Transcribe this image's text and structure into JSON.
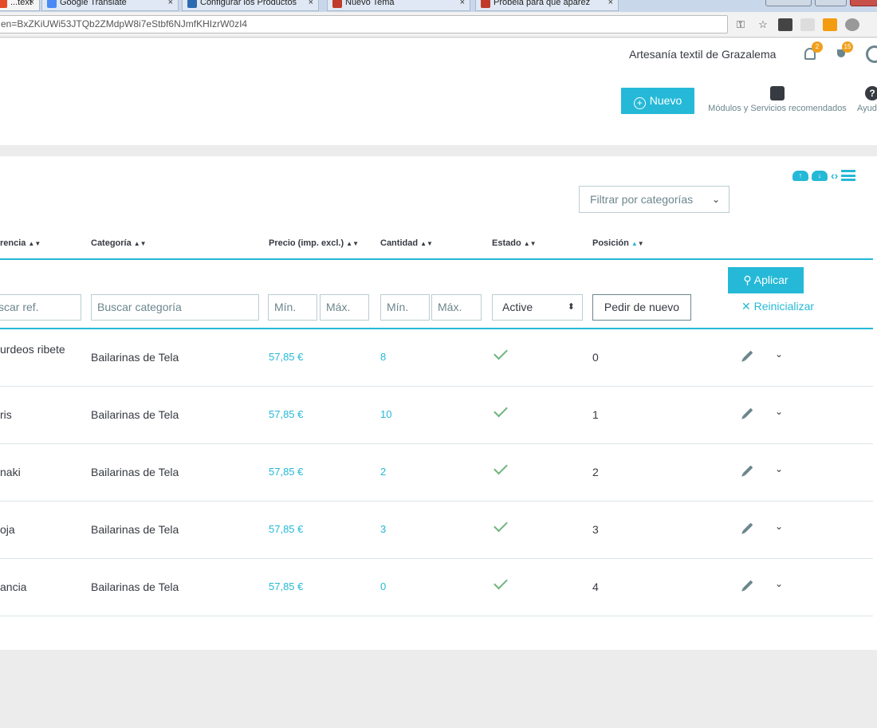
{
  "browser": {
    "tabs": [
      {
        "label": "...text",
        "close": "×"
      },
      {
        "label": "Google Translate",
        "close": "×"
      },
      {
        "label": "Configurar los Productos",
        "close": "×"
      },
      {
        "label": "Nuevo Tema",
        "close": "×"
      },
      {
        "label": "Probela para que aparez",
        "close": "×"
      }
    ],
    "url": "en=BxZKiUWi53JTQb2ZMdpW8i7eStbf6NJmfKHIzrW0zI4",
    "key_icon": "⚿",
    "star_icon": "☆"
  },
  "header": {
    "shop_name": "Artesanía textil de Grazalema",
    "notifications_count": "2",
    "trophy_count": "15",
    "new_button": "Nuevo",
    "new_plus": "+",
    "modules_label": "Módulos y Servicios recomendados",
    "help_label": "Ayuda",
    "help_icon": "?"
  },
  "card": {
    "category_filter": "Filtrar por categorías",
    "category_filter_chevron": "⌄",
    "columns": {
      "reference": "rencia",
      "category": "Categoría",
      "price": "Precio (imp. excl.)",
      "quantity": "Cantidad",
      "status": "Estado",
      "position": "Posición",
      "sort_up": "▲",
      "sort_down": "▼"
    },
    "filters": {
      "ref_placeholder": "scar ref.",
      "category_placeholder": "Buscar categoría",
      "price_min": "Mín.",
      "price_max": "Máx.",
      "qty_min": "Mín.",
      "qty_max": "Máx.",
      "status_value": "Active",
      "status_caret": "⬍",
      "reorder_button": "Pedir de nuevo",
      "apply_button": "Aplicar",
      "apply_icon": "⚲",
      "reset_button": "Reinicializar",
      "reset_icon": "✕"
    },
    "rows": [
      {
        "name": "urdeos ribete",
        "category": "Bailarinas de Tela",
        "price": "57,85 €",
        "quantity": "8",
        "position": "0",
        "active": true
      },
      {
        "name": "ris",
        "category": "Bailarinas de Tela",
        "price": "57,85 €",
        "quantity": "10",
        "position": "1",
        "active": true
      },
      {
        "name": "naki",
        "category": "Bailarinas de Tela",
        "price": "57,85 €",
        "quantity": "2",
        "position": "2",
        "active": true
      },
      {
        "name": "oja",
        "category": "Bailarinas de Tela",
        "price": "57,85 €",
        "quantity": "3",
        "position": "3",
        "active": true
      },
      {
        "name": "ancia",
        "category": "Bailarinas de Tela",
        "price": "57,85 €",
        "quantity": "0",
        "position": "4",
        "active": true
      }
    ],
    "row_dropdown": "⌄",
    "tool_upload": "↑",
    "tool_download": "↓",
    "tool_code": "‹›"
  },
  "colors": {
    "accent": "#25b9d7",
    "success": "#70b580",
    "badge": "#f0a01c"
  }
}
